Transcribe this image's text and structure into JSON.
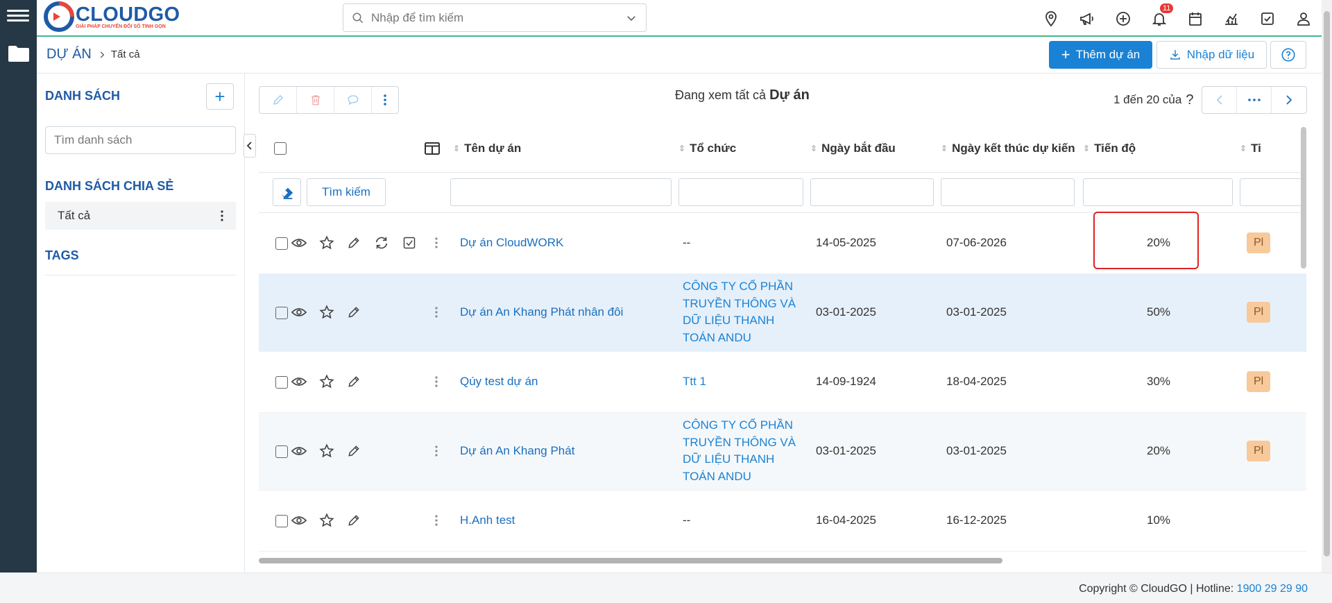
{
  "app": {
    "name": "CLOUDGO",
    "tagline": "GIẢI PHÁP CHUYỂN ĐỔI SỐ TINH GỌN"
  },
  "search": {
    "placeholder": "Nhập để tìm kiếm"
  },
  "notifications": {
    "count": "11"
  },
  "topicons": [
    "map-pin-icon",
    "megaphone-icon",
    "plus-circle-icon",
    "bell-icon",
    "calendar-icon",
    "chart-icon",
    "checkbox-icon",
    "user-icon"
  ],
  "breadcrumb": {
    "module": "DỰ ÁN",
    "current": "Tất cả"
  },
  "actions": {
    "add_project": "Thêm dự án",
    "import": "Nhập dữ liệu"
  },
  "sidebar": {
    "list_title": "DANH SÁCH",
    "search_placeholder": "Tìm danh sách",
    "shared_title": "DANH SÁCH CHIA SẺ",
    "items": [
      {
        "label": "Tất cả"
      }
    ],
    "tags_title": "TAGS"
  },
  "viewing": {
    "prefix": "Đang xem tất cả",
    "entity": "Dự án"
  },
  "pager": {
    "text": "1 đến 20 của",
    "help": "?"
  },
  "filter": {
    "search_button": "Tìm kiếm"
  },
  "table": {
    "columns": [
      "Tên dự án",
      "Tổ chức",
      "Ngày bắt đầu",
      "Ngày kết thúc dự kiến",
      "Tiến độ",
      "Ti"
    ],
    "rows": [
      {
        "name": "Dự án CloudWORK",
        "org": "--",
        "start": "14-05-2025",
        "end": "07-06-2026",
        "progress": "20%",
        "status": "Pl"
      },
      {
        "name": "Dự án An Khang Phát nhân đôi",
        "org": "CÔNG TY CỔ PHẦN TRUYỀN THÔNG VÀ DỮ LIỆU THANH TOÁN ANDU",
        "start": "03-01-2025",
        "end": "03-01-2025",
        "progress": "50%",
        "status": "Pl"
      },
      {
        "name": "Qúy test dự án",
        "org": "Ttt 1",
        "start": "14-09-1924",
        "end": "18-04-2025",
        "progress": "30%",
        "status": "Pl"
      },
      {
        "name": "Dự án An Khang Phát",
        "org": "CÔNG TY CỔ PHẦN TRUYỀN THÔNG VÀ DỮ LIỆU THANH TOÁN ANDU",
        "start": "03-01-2025",
        "end": "03-01-2025",
        "progress": "20%",
        "status": "Pl"
      },
      {
        "name": "H.Anh test",
        "org": "--",
        "start": "16-04-2025",
        "end": "16-12-2025",
        "progress": "10%",
        "status": ""
      }
    ]
  },
  "footer": {
    "copyright": "Copyright © CloudGO | Hotline: ",
    "hotline": "1900 29 29 90"
  },
  "colors": {
    "brand": "#1f5aa6",
    "accent": "#1a82d5",
    "rail": "#263845",
    "highlight": "#e02020"
  }
}
